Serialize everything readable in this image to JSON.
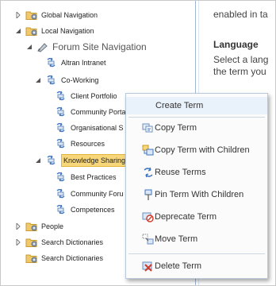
{
  "tree": {
    "items": [
      {
        "label": "Global Navigation",
        "arrow": "collapsed",
        "icon": "folder-gear-icon"
      },
      {
        "label": "Local Navigation",
        "arrow": "expanded",
        "icon": "folder-gear-icon"
      },
      {
        "label": "Forum Site Navigation",
        "arrow": "expanded",
        "icon": "pencil-tag-icon"
      },
      {
        "label": "Altran Intranet",
        "arrow": "none",
        "icon": "term-icon"
      },
      {
        "label": "Co-Working",
        "arrow": "expanded",
        "icon": "term-icon"
      },
      {
        "label": "Client Portfolio",
        "arrow": "none",
        "icon": "term-icon"
      },
      {
        "label": "Community Porta",
        "arrow": "none",
        "icon": "term-icon"
      },
      {
        "label": "Organisational S",
        "arrow": "none",
        "icon": "term-icon"
      },
      {
        "label": "Resources",
        "arrow": "none",
        "icon": "term-icon"
      },
      {
        "label": "Knowledge Sharing",
        "arrow": "expanded",
        "icon": "term-icon"
      },
      {
        "label": "Best Practices",
        "arrow": "none",
        "icon": "term-icon"
      },
      {
        "label": "Community Foru",
        "arrow": "none",
        "icon": "term-icon"
      },
      {
        "label": "Competences",
        "arrow": "none",
        "icon": "term-icon"
      },
      {
        "label": "People",
        "arrow": "collapsed",
        "icon": "folder-gear-icon"
      },
      {
        "label": "Search Dictionaries",
        "arrow": "collapsed",
        "icon": "folder-gear-icon"
      },
      {
        "label": "Search Dictionaries",
        "arrow": "none",
        "icon": "folder-gear-icon"
      }
    ]
  },
  "right_panel": {
    "line1": "enabled in ta",
    "heading": "Language",
    "line2": "Select a lang",
    "line3": "the term you"
  },
  "context_menu": {
    "items": [
      {
        "label": "Create Term",
        "icon": ""
      },
      {
        "label": "Copy Term",
        "icon": "copy-term-icon"
      },
      {
        "label": "Copy Term with Children",
        "icon": "copy-term-children-icon"
      },
      {
        "label": "Reuse Terms",
        "icon": "reuse-terms-icon"
      },
      {
        "label": "Pin Term With Children",
        "icon": "pin-term-icon"
      },
      {
        "label": "Deprecate Term",
        "icon": "deprecate-term-icon"
      },
      {
        "label": "Move Term",
        "icon": "move-term-icon"
      },
      {
        "label": "Delete Term",
        "icon": "delete-term-icon"
      }
    ]
  },
  "colors": {
    "selection_bg": "#f7d77a",
    "menu_highlight": "#e9f1fb",
    "divider": "#9fb7d4"
  }
}
